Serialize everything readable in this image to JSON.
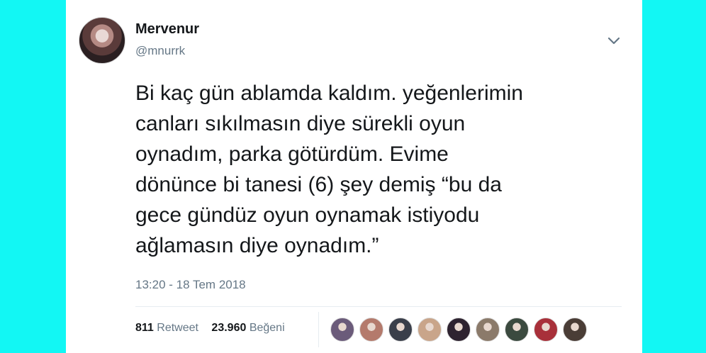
{
  "tweet": {
    "author_name": "Mervenur",
    "author_handle": "@mnurrk",
    "text": "Bi kaç gün ablamda kaldım. yeğenlerimin\ncanları sıkılmasın diye sürekli oyun\noynadım, parka götürdüm. Evime\ndönünce bi tanesi (6) şey demiş “bu da\ngece gündüz oyun oynamak istiyodu\nağlamasın diye oynadım.”",
    "timestamp": "13:20 - 18 Tem 2018",
    "retweets_count": "811",
    "retweets_label": "Retweet",
    "likes_count": "23.960",
    "likes_label": "Beğeni"
  },
  "icons": {
    "menu": "chevron-down-icon"
  },
  "likers": [
    {
      "color": "#6b5b7a"
    },
    {
      "color": "#b47a6c"
    },
    {
      "color": "#3a3f4a"
    },
    {
      "color": "#c9a58a"
    },
    {
      "color": "#2e2330"
    },
    {
      "color": "#8b7a6a"
    },
    {
      "color": "#3b4a3f"
    },
    {
      "color": "#a8303a"
    },
    {
      "color": "#4a3d36"
    }
  ]
}
